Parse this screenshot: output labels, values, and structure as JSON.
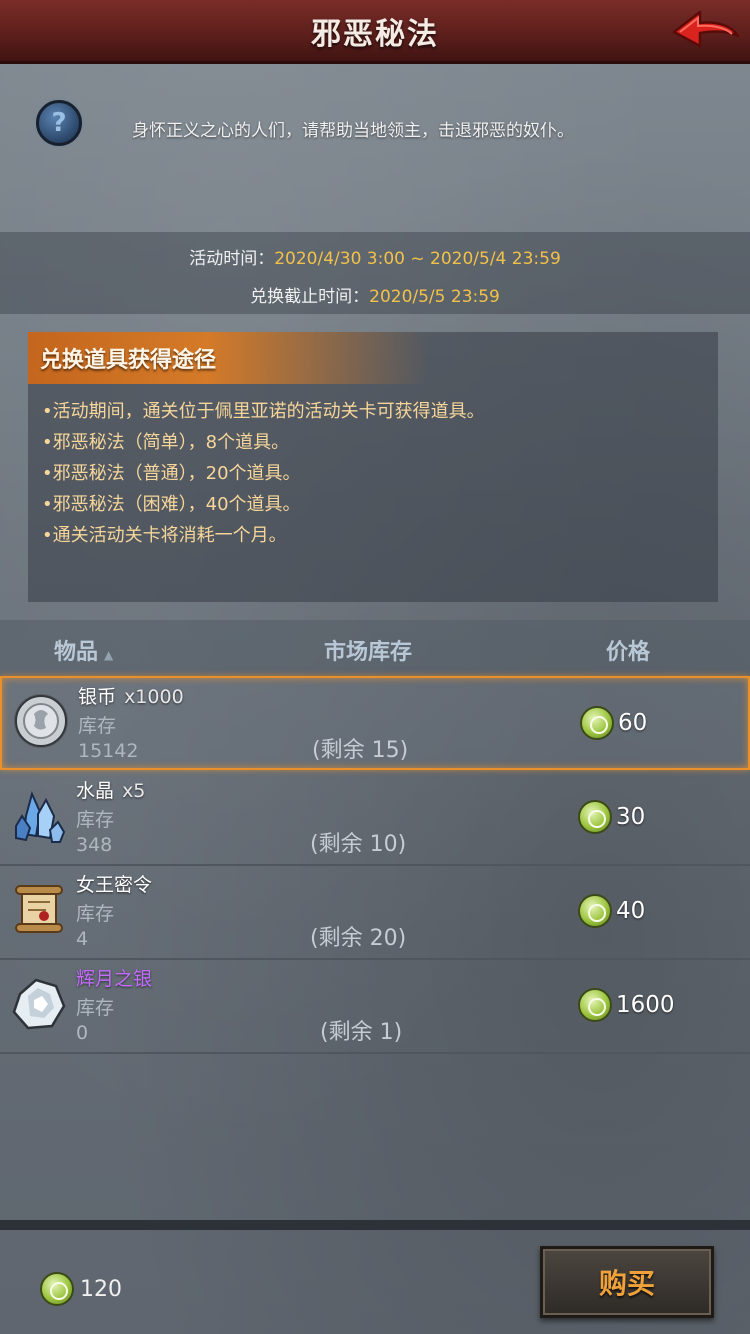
{
  "header": {
    "title": "邪恶秘法"
  },
  "description": {
    "text": "身怀正义之心的人们，请帮助当地领主，击退邪恶的奴仆。"
  },
  "time": {
    "event_label": "活动时间：",
    "event_value": "2020/4/30 3:00 ~ 2020/5/4 23:59",
    "exchange_label": "兑换截止时间：",
    "exchange_value": "2020/5/5 23:59"
  },
  "info": {
    "title": "兑换道具获得途径",
    "lines": [
      "•活动期间，通关位于佩里亚诺的活动关卡可获得道具。",
      "•邪恶秘法（简单），8个道具。",
      "•邪恶秘法（普通），20个道具。",
      "•邪恶秘法（困难），40个道具。",
      "•通关活动关卡将消耗一个月。"
    ]
  },
  "table": {
    "col_item": "物品",
    "col_stock": "市场库存",
    "col_price": "价格",
    "sort_icon": "▲",
    "rows": [
      {
        "name": "银币",
        "qty": "x1000",
        "stock_label": "库存",
        "stock": "15142",
        "remain": "(剩余 15)",
        "price": "60",
        "icon": "silver-coin-icon",
        "rarity": "normal",
        "selected": true
      },
      {
        "name": "水晶",
        "qty": "x5",
        "stock_label": "库存",
        "stock": "348",
        "remain": "(剩余 10)",
        "price": "30",
        "icon": "crystal-icon",
        "rarity": "normal",
        "selected": false
      },
      {
        "name": "女王密令",
        "qty": "",
        "stock_label": "库存",
        "stock": "4",
        "remain": "(剩余 20)",
        "price": "40",
        "icon": "scroll-icon",
        "rarity": "normal",
        "selected": false
      },
      {
        "name": "辉月之银",
        "qty": "",
        "stock_label": "库存",
        "stock": "0",
        "remain": "(剩余 1)",
        "price": "1600",
        "icon": "moon-silver-icon",
        "rarity": "rare",
        "selected": false
      }
    ]
  },
  "footer": {
    "balance": "120",
    "buy_label": "购买"
  },
  "colors": {
    "accent": "#f0a13a",
    "rare": "#c46cff",
    "time_value": "#f2c14a",
    "info_text": "#f6d69a"
  }
}
